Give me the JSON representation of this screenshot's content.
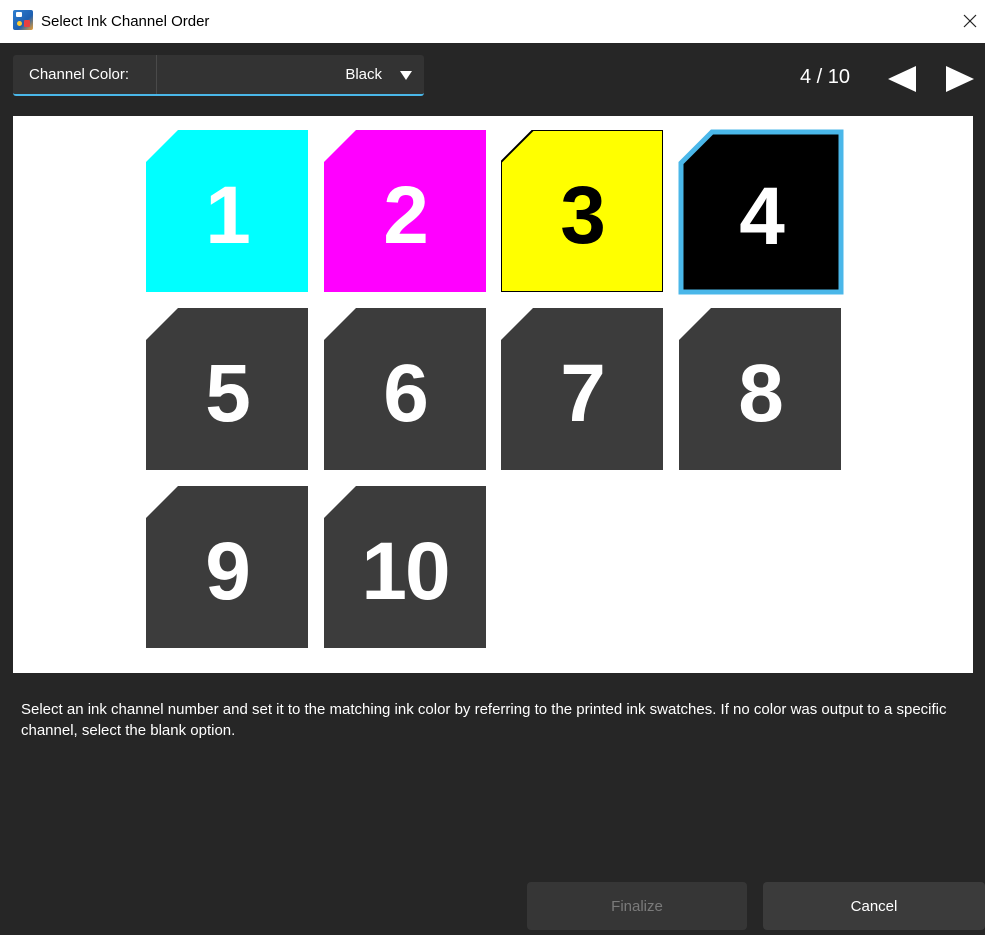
{
  "window": {
    "title": "Select Ink Channel Order"
  },
  "toolbar": {
    "channel_label": "Channel Color:",
    "channel_value": "Black",
    "page_counter": "4 / 10"
  },
  "tiles": [
    {
      "number": "1",
      "fill": "#00ffff",
      "text_color": "#ffffff",
      "border": "none",
      "selected": false
    },
    {
      "number": "2",
      "fill": "#ff00ff",
      "text_color": "#ffffff",
      "border": "none",
      "selected": false
    },
    {
      "number": "3",
      "fill": "#ffff00",
      "text_color": "#000000",
      "border": "#000000",
      "selected": false
    },
    {
      "number": "4",
      "fill": "#000000",
      "text_color": "#ffffff",
      "border": "#4ab7e9",
      "selected": true
    },
    {
      "number": "5",
      "fill": "#3c3c3c",
      "text_color": "#ffffff",
      "border": "none",
      "selected": false
    },
    {
      "number": "6",
      "fill": "#3c3c3c",
      "text_color": "#ffffff",
      "border": "none",
      "selected": false
    },
    {
      "number": "7",
      "fill": "#3c3c3c",
      "text_color": "#ffffff",
      "border": "none",
      "selected": false
    },
    {
      "number": "8",
      "fill": "#3c3c3c",
      "text_color": "#ffffff",
      "border": "none",
      "selected": false
    },
    {
      "number": "9",
      "fill": "#3c3c3c",
      "text_color": "#ffffff",
      "border": "none",
      "selected": false
    },
    {
      "number": "10",
      "fill": "#3c3c3c",
      "text_color": "#ffffff",
      "border": "none",
      "selected": false
    }
  ],
  "description": "Select an ink channel number and set it to the matching ink color by referring to the printed ink swatches. If no color was output to a specific channel, select the blank option.",
  "buttons": {
    "finalize": "Finalize",
    "cancel": "Cancel"
  },
  "colors": {
    "accent": "#4ab7e9",
    "background": "#262626"
  },
  "icons": {
    "app": "app-icon",
    "close": "close-icon",
    "dropdown": "triangle-down-icon",
    "prev": "triangle-left-icon",
    "next": "triangle-right-icon"
  }
}
